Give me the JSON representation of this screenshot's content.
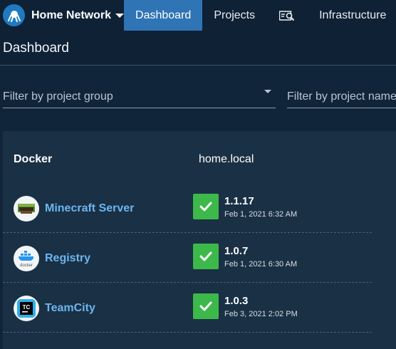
{
  "nav": {
    "space_name": "Home Network",
    "tabs": [
      {
        "label": "Dashboard",
        "active": true
      },
      {
        "label": "Projects",
        "active": false
      },
      {
        "label": "",
        "icon": "search-icon"
      },
      {
        "label": "Infrastructure",
        "active": false
      }
    ]
  },
  "page": {
    "title": "Dashboard"
  },
  "filters": {
    "project_group_placeholder": "Filter by project group",
    "project_name_placeholder": "Filter by project name"
  },
  "dashboard": {
    "group_name": "Docker",
    "environment": "home.local",
    "projects": [
      {
        "name": "Minecraft Server",
        "icon": "minecraft-icon",
        "version": "1.1.17",
        "date": "Feb 1, 2021 6:32 AM",
        "status": "success"
      },
      {
        "name": "Registry",
        "icon": "docker-icon",
        "version": "1.0.7",
        "date": "Feb 1, 2021 6:30 AM",
        "status": "success"
      },
      {
        "name": "TeamCity",
        "icon": "teamcity-icon",
        "version": "1.0.3",
        "date": "Feb 3, 2021 2:02 PM",
        "status": "success"
      }
    ]
  },
  "colors": {
    "nav_bg": "#0f2135",
    "active_tab": "#2f74b5",
    "success": "#3cb94a",
    "project_link": "#6bb5f0"
  }
}
